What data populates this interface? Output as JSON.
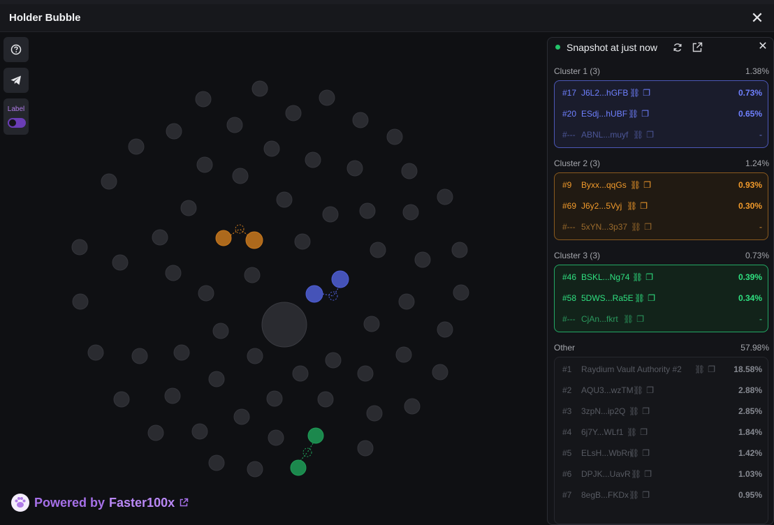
{
  "modal": {
    "title": "Holder Bubble"
  },
  "toolbar": {
    "label_toggle": "Label"
  },
  "footer": {
    "powered": "Powered by",
    "brand": "Faster100x"
  },
  "panel": {
    "title": "Snapshot at just now",
    "clusters": [
      {
        "name": "Cluster 1 (3)",
        "pct": "1.38%",
        "color": "#6f80ff",
        "rows": [
          {
            "rank": "#17",
            "addr": "J6L2...hGFB",
            "pct": "0.73%"
          },
          {
            "rank": "#20",
            "addr": "ESdj...hUBF",
            "pct": "0.65%"
          },
          {
            "rank": "#---",
            "addr": "ABNL...muyf",
            "pct": "-"
          }
        ]
      },
      {
        "name": "Cluster 2 (3)",
        "pct": "1.24%",
        "color": "#f19a2b",
        "rows": [
          {
            "rank": "#9",
            "addr": "Byxx...qqGs",
            "pct": "0.93%"
          },
          {
            "rank": "#69",
            "addr": "J6y2...5Vyj",
            "pct": "0.30%"
          },
          {
            "rank": "#---",
            "addr": "5xYN...3p37",
            "pct": "-"
          }
        ]
      },
      {
        "name": "Cluster 3 (3)",
        "pct": "0.73%",
        "color": "#2fe080",
        "rows": [
          {
            "rank": "#46",
            "addr": "BSKL...Ng74",
            "pct": "0.39%"
          },
          {
            "rank": "#58",
            "addr": "5DWS...Ra5E",
            "pct": "0.34%"
          },
          {
            "rank": "#---",
            "addr": "CjAn...fkrt",
            "pct": "-"
          }
        ]
      }
    ],
    "other": {
      "name": "Other",
      "pct": "57.98%",
      "rows": [
        {
          "rank": "#1",
          "addr": "Raydium Vault Authority #2",
          "pct": "18.58%"
        },
        {
          "rank": "#2",
          "addr": "AQU3...wzTM",
          "pct": "2.88%"
        },
        {
          "rank": "#3",
          "addr": "3zpN...ip2Q",
          "pct": "2.85%"
        },
        {
          "rank": "#4",
          "addr": "6j7Y...WLf1",
          "pct": "1.84%"
        },
        {
          "rank": "#5",
          "addr": "ELsH...WbRn",
          "pct": "1.42%"
        },
        {
          "rank": "#6",
          "addr": "DPJK...UavR",
          "pct": "1.03%"
        },
        {
          "rank": "#7",
          "addr": "8egB...FKDx",
          "pct": "0.95%"
        }
      ]
    }
  },
  "colors": {
    "cluster1": "#4f5fd6",
    "cluster2": "#c9791e",
    "cluster3": "#1f9e58",
    "bubble": "#2a2b30"
  }
}
